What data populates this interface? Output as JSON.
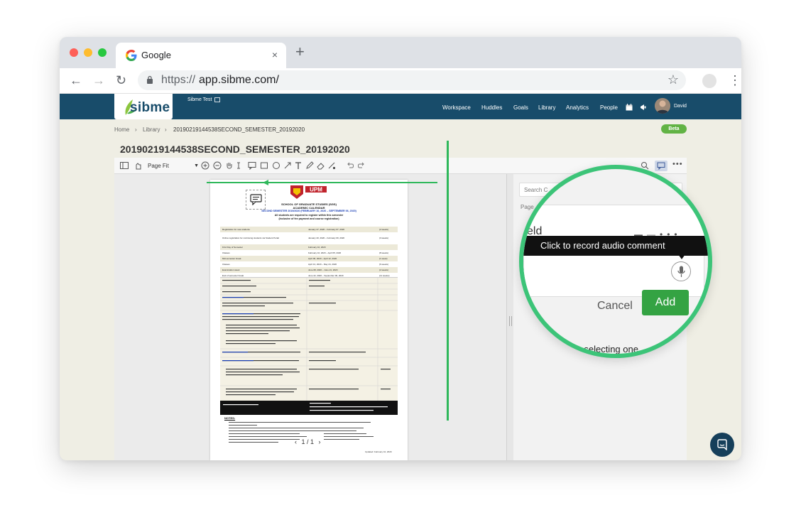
{
  "browser": {
    "tab_title": "Google",
    "tab_close": "×",
    "new_tab": "+",
    "url_scheme": "https://",
    "url_host": "app.sibme.com/",
    "back": "←",
    "forward": "→",
    "reload": "↻",
    "bookmark": "☆",
    "menu": "⋮"
  },
  "app": {
    "logo_text": "sibme",
    "account_name": "Sibme Test",
    "nav": [
      "Workspace",
      "Huddles",
      "Goals",
      "Library",
      "Analytics",
      "People"
    ],
    "user_name": "David",
    "brand_color": "#184c6a",
    "accent_color": "#2fb85b"
  },
  "breadcrumb": {
    "items": [
      "Home",
      "Library",
      "20190219144538SECOND_SEMESTER_20192020"
    ],
    "separator": "›"
  },
  "beta": "Beta",
  "document": {
    "title": "20190219144538SECOND_SEMESTER_20192020",
    "zoom": "Page Fit",
    "pager": "1 / 1",
    "prev": "‹",
    "next": "›",
    "page_heading": "SCHOOL OF GRADUATE STUDIES (SGS)",
    "page_subheading": "ACADEMIC CALENDAR",
    "page_semester": "SECOND SEMESTER 2019/2020 (FEBRUARY 10, 2020 – SEPTEMBER 06, 2020)",
    "page_note1": "All students are required to register within this semester",
    "page_note2": "(Inclusive of fee payment and course registration)",
    "logo_text": "UPM",
    "rows": [
      {
        "a": "Registration for new students",
        "b": "January 27, 2020 – February 07, 2020",
        "c": "(2 weeks)"
      },
      {
        "a": "Online registration for continuing students via Student Portal",
        "b": "January 20, 2020 – February 09, 2020",
        "c": "(3 weeks)"
      },
      {
        "a": "First Day of Semester",
        "b": "February 10, 2020",
        "c": ""
      },
      {
        "a": "Classes",
        "b": "February 10, 2020 – April 05, 2020",
        "c": "(8 weeks)"
      },
      {
        "a": "Mid-semester break",
        "b": "April 06, 2020 – April 12, 2020",
        "c": "(1 week)"
      },
      {
        "a": "Classes",
        "b": "April 13, 2020 – May 24, 2020",
        "c": "(6 weeks)"
      },
      {
        "a": "Examination week",
        "b": "June 08, 2020 – June 21, 2020",
        "c": "(2 weeks)"
      },
      {
        "a": "End of semester break",
        "b": "June 22, 2020 – September 06, 2020",
        "c": "(11 weeks)"
      }
    ],
    "notes_title": "NOTES:",
    "signature": "Updated: February 10, 2020"
  },
  "panel": {
    "search_placeholder": "Search C",
    "page_label": "Page"
  },
  "lens": {
    "field_label": "eld",
    "tooltip": "Click to record audio comment",
    "cancel": "Cancel",
    "add": "Add",
    "hint": "by selecting one"
  }
}
